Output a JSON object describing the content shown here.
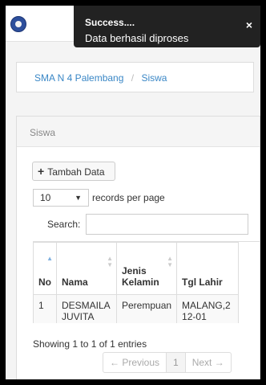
{
  "toast": {
    "title": "Success....",
    "message": "Data berhasil diproses",
    "close_glyph": "×"
  },
  "breadcrumb": {
    "items": [
      "SMA N 4 Palembang",
      "Siswa"
    ],
    "separator": "/"
  },
  "panel": {
    "title": "Siswa"
  },
  "toolbar": {
    "add_icon": "plus-icon",
    "add_label": "Tambah Data"
  },
  "length": {
    "value": "10",
    "label": "records per page"
  },
  "search": {
    "label": "Search:",
    "value": ""
  },
  "table": {
    "headers": [
      {
        "label": "No",
        "sort": "asc"
      },
      {
        "label": "Nama",
        "sort": "none"
      },
      {
        "label": "Jenis\nKelamin",
        "sort": "none"
      },
      {
        "label": "Tgl Lahir",
        "sort": "none"
      }
    ],
    "rows": [
      [
        "1",
        "DESMAILA JUVITA",
        "Perempuan",
        "MALANG,2\n12-01"
      ]
    ]
  },
  "info": "Showing 1 to 1 of 1 entries",
  "pager": {
    "prev": "← Previous",
    "page": "1",
    "next": "Next →"
  },
  "colors": {
    "toast_bg": "#222222",
    "link": "#3a87c6",
    "logo": "#2d4f9c"
  }
}
